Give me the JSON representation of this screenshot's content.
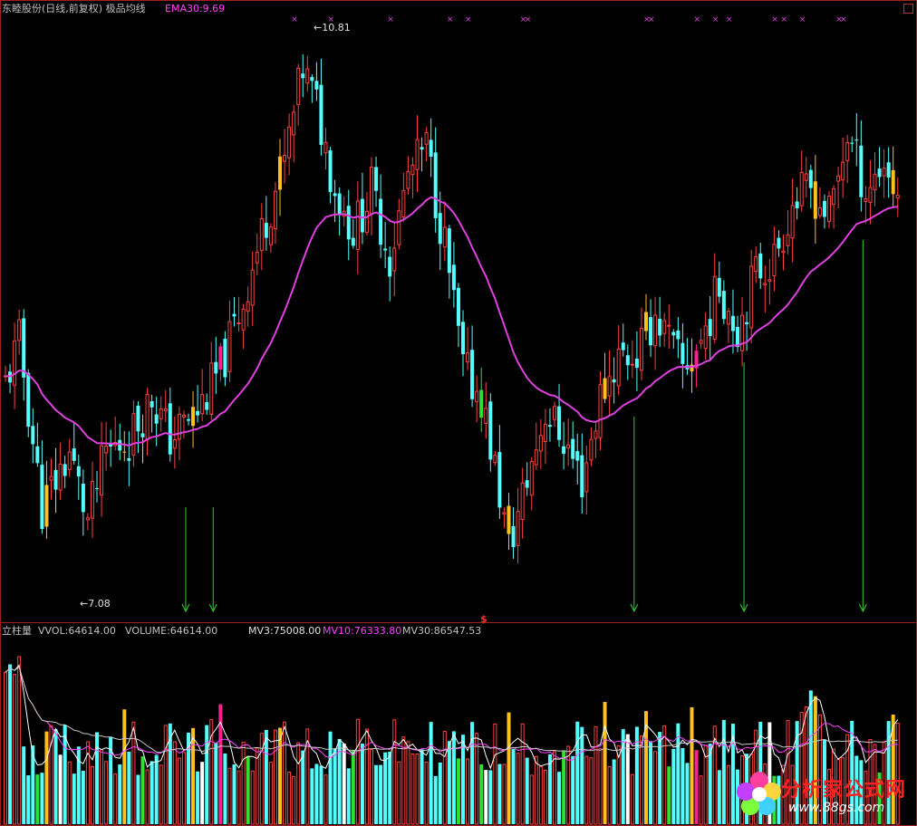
{
  "header": {
    "title": "东睦股份(日线,前复权) 极品均线",
    "ema_label": "EMA30:9.69"
  },
  "volume_panel": {
    "name": "立柱量",
    "vvol": "VVOL:64614.00",
    "volume": "VOLUME:64614.00",
    "mv3": "MV3:75008.00",
    "mv10": "MV10:76333.80",
    "mv30": "MV30:86547.53"
  },
  "annotations": {
    "high_label": "10.81",
    "low_label": "7.08",
    "dollar_mark": "$"
  },
  "watermark": {
    "text": "分析家公式网",
    "url": "www.88gs.com"
  },
  "colors": {
    "up": "#ff4040",
    "down": "#54ffff",
    "ema": "#e040e0",
    "signal_yellow": "#ffc020",
    "signal_green": "#30e030",
    "signal_magenta": "#ff2090",
    "arrow": "#30d030",
    "cross": "#e040e0"
  },
  "chart_data": {
    "type": "candlestick",
    "series_name": "EMA30",
    "price_range": [
      6.9,
      11.1
    ],
    "high": 10.81,
    "low": 7.08,
    "cross_marks_at_index": [
      63,
      71,
      84,
      97,
      101,
      113,
      114,
      140,
      141,
      151,
      155,
      158,
      168,
      170,
      174,
      182,
      183
    ],
    "arrow_at_index": [
      39,
      45,
      137,
      161,
      187
    ],
    "volume_range": [
      0,
      190000
    ]
  }
}
